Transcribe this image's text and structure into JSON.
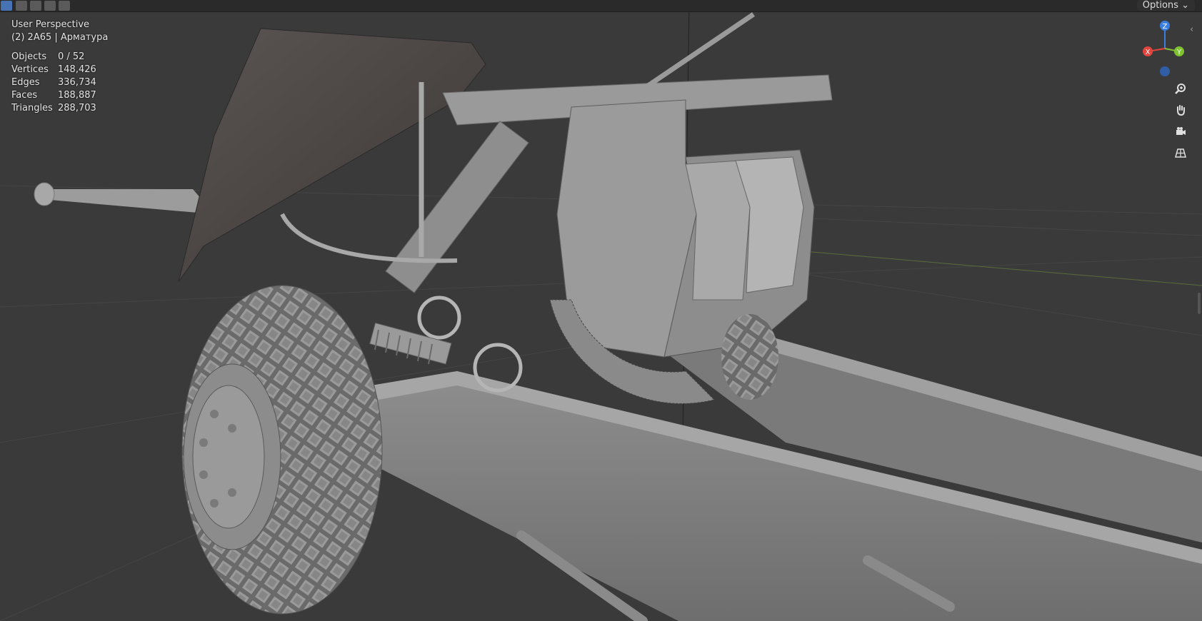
{
  "viewport": {
    "mode": "User Perspective",
    "object": "(2) 2A65 | Арматура"
  },
  "stats": [
    {
      "label": "Objects",
      "value": "0 / 52"
    },
    {
      "label": "Vertices",
      "value": "148,426"
    },
    {
      "label": "Edges",
      "value": "336,734"
    },
    {
      "label": "Faces",
      "value": "188,887"
    },
    {
      "label": "Triangles",
      "value": "288,703"
    }
  ],
  "header": {
    "options_label": "Options"
  },
  "gizmo": {
    "x": "X",
    "y": "Y",
    "z": "Z"
  },
  "nav_icons": [
    "zoom-icon",
    "pan-hand-icon",
    "camera-icon",
    "grid-icon"
  ],
  "colors": {
    "x_axis": "#e2453d",
    "y_axis": "#7fc331",
    "z_axis": "#3a7ee3",
    "background": "#3a3a3a"
  }
}
